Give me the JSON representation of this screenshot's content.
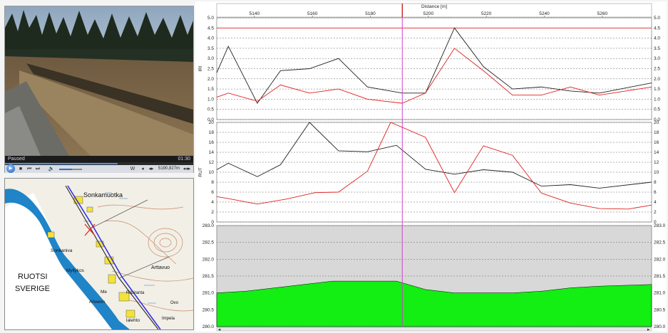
{
  "video": {
    "status": "Paused",
    "time": "01:30",
    "progress": 0.6,
    "volume": 0.55,
    "position_readout": "5190,827m",
    "controls": {
      "play_icon": "play-icon",
      "stop_icon": "stop-icon",
      "prev_icon": "previous-icon",
      "next_icon": "next-icon",
      "volume_icon": "speaker-icon",
      "label_w": "W",
      "label_step": "◂◂ ▸"
    }
  },
  "map": {
    "labels": [
      {
        "text": "Sonkamuotka",
        "size": 9
      },
      {
        "text": "Sonkaniva",
        "size": 6.5
      },
      {
        "text": "Myllykos",
        "size": 6.5
      },
      {
        "text": "Arttavuo",
        "size": 7
      },
      {
        "text": "RUOTSI",
        "size": 11
      },
      {
        "text": "SVERIGE",
        "size": 11
      },
      {
        "text": "Me",
        "size": 6.5
      },
      {
        "text": "Riipiranta",
        "size": 6
      },
      {
        "text": "Ahvenn",
        "size": 6.5
      },
      {
        "text": "lalehto",
        "size": 6.5
      },
      {
        "text": "Impela",
        "size": 6
      },
      {
        "text": "Ovo",
        "size": 6
      }
    ]
  },
  "chart_data": [
    {
      "type": "line",
      "ylabel": "IRI",
      "xlabel": "Distance [m]",
      "xlim": [
        5127,
        5277
      ],
      "ylim": [
        0,
        5
      ],
      "xticks": [
        5140,
        5160,
        5180,
        5200,
        5220,
        5240,
        5260
      ],
      "yticks": [
        "0.0",
        "0.5",
        "1.0",
        "1.5",
        "2.0",
        "2.5",
        "3.0",
        "3.5",
        "4.0",
        "4.5",
        "5.0"
      ],
      "threshold": 4.5,
      "cursor_x": 5191,
      "series": [
        {
          "color": "#222222",
          "x": [
            5127,
            5131,
            5141,
            5149,
            5159,
            5169,
            5179,
            5191,
            5199,
            5209,
            5219,
            5229,
            5239,
            5249,
            5259,
            5277
          ],
          "y": [
            2.3,
            3.6,
            0.8,
            2.4,
            2.5,
            3.0,
            1.6,
            1.3,
            1.3,
            4.5,
            2.6,
            1.5,
            1.6,
            1.4,
            1.3,
            1.8
          ]
        },
        {
          "color": "#e02020",
          "x": [
            5127,
            5131,
            5141,
            5149,
            5159,
            5169,
            5179,
            5191,
            5199,
            5209,
            5219,
            5229,
            5239,
            5249,
            5259,
            5277
          ],
          "y": [
            1.1,
            1.3,
            0.9,
            1.7,
            1.3,
            1.5,
            1.0,
            0.8,
            1.3,
            3.5,
            2.4,
            1.2,
            1.2,
            1.6,
            1.2,
            1.6
          ]
        }
      ]
    },
    {
      "type": "line",
      "ylabel": "RUT",
      "xlim": [
        5127,
        5277
      ],
      "ylim": [
        0,
        20
      ],
      "yticks": [
        "0",
        "2",
        "4",
        "6",
        "8",
        "10",
        "12",
        "14",
        "16",
        "18",
        "20"
      ],
      "series": [
        {
          "color": "#222222",
          "x": [
            5127,
            5131,
            5141,
            5149,
            5159,
            5169,
            5179,
            5189,
            5199,
            5209,
            5219,
            5229,
            5239,
            5249,
            5259,
            5277
          ],
          "y": [
            10.5,
            11.8,
            9.1,
            11.5,
            20.2,
            14.3,
            14.1,
            15.4,
            10.6,
            9.6,
            10.5,
            10.0,
            7.2,
            7.5,
            6.8,
            8.0
          ]
        },
        {
          "color": "#e02020",
          "x": [
            5127,
            5131,
            5141,
            5151,
            5161,
            5169,
            5179,
            5187,
            5199,
            5209,
            5219,
            5229,
            5239,
            5249,
            5259,
            5269,
            5277
          ],
          "y": [
            5.1,
            4.7,
            3.6,
            4.6,
            5.9,
            6.0,
            10.2,
            21.0,
            17.0,
            5.9,
            15.3,
            13.4,
            5.8,
            3.8,
            2.7,
            2.6,
            3.4
          ]
        }
      ]
    },
    {
      "type": "area",
      "xlim": [
        5127,
        5277
      ],
      "ylim": [
        280.0,
        283.0
      ],
      "yticks": [
        "280.0",
        "280.5",
        "281.0",
        "281.5",
        "282.0",
        "282.5",
        "283.0"
      ],
      "fill_color": "#13ee13",
      "x": [
        5127,
        5137,
        5147,
        5157,
        5167,
        5177,
        5189,
        5199,
        5209,
        5219,
        5229,
        5239,
        5249,
        5259,
        5277
      ],
      "y": [
        281.0,
        281.05,
        281.15,
        281.25,
        281.35,
        281.35,
        281.35,
        281.1,
        281.0,
        281.0,
        281.0,
        281.05,
        281.15,
        281.2,
        281.25
      ]
    }
  ]
}
